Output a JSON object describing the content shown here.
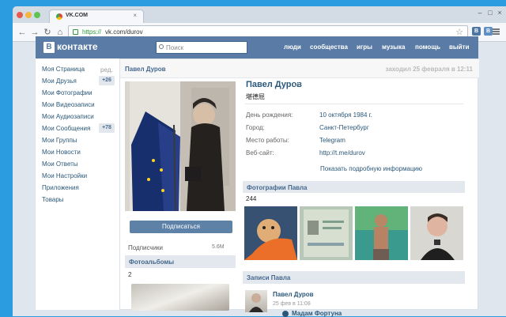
{
  "browser": {
    "tab_title": "VK.COM",
    "url_scheme": "https://",
    "url_rest": "vk.com/durov",
    "extension_b": "B",
    "extension_v": "B"
  },
  "vk": {
    "logo_box": "B",
    "logo_text": "контакте",
    "search_placeholder": "Поиск",
    "nav": [
      "люди",
      "сообщества",
      "игры",
      "музыка",
      "помощь",
      "выйти"
    ]
  },
  "left_menu": {
    "edit": "ред.",
    "items": [
      "Моя Страница",
      "Мои Друзья",
      "Мои Фотографии",
      "Мои Видеозаписи",
      "Мои Аудиозаписи",
      "Мои Сообщения",
      "Мои Группы",
      "Мои Новости",
      "Мои Ответы",
      "Мои Настройки",
      "Приложения",
      "Товары"
    ],
    "friends_badge": "+26",
    "messages_badge": "+78"
  },
  "profile": {
    "header_name": "Павел Дуров",
    "last_seen": "заходил 25 февраля в 12:11",
    "name": "Павел Дуров",
    "status": "堪德屈",
    "subscribe": "Подписаться",
    "followers_label": "Подписчики",
    "followers_count": "5.6M",
    "albums_title": "Фотоальбомы",
    "albums_count": "2",
    "info": [
      {
        "label": "День рождения:",
        "value": "10 октября 1984 г."
      },
      {
        "label": "Город:",
        "value": "Санкт-Петербург"
      },
      {
        "label": "Место работы:",
        "value": "Telegram"
      },
      {
        "label": "Веб-сайт:",
        "value": "http://t.me/durov"
      }
    ],
    "show_more": "Показать подробную информацию",
    "photos_title": "Фотографии Павла",
    "photos_count": "244",
    "wall_title": "Записи Павла",
    "post": {
      "author": "Павел Дуров",
      "date": "25 фев в 11:08",
      "repost_author": "Мадам Фортуна"
    }
  },
  "colors": {
    "vk_blue": "#597ba5",
    "link": "#2b587a",
    "background": "#2b9ce0"
  }
}
